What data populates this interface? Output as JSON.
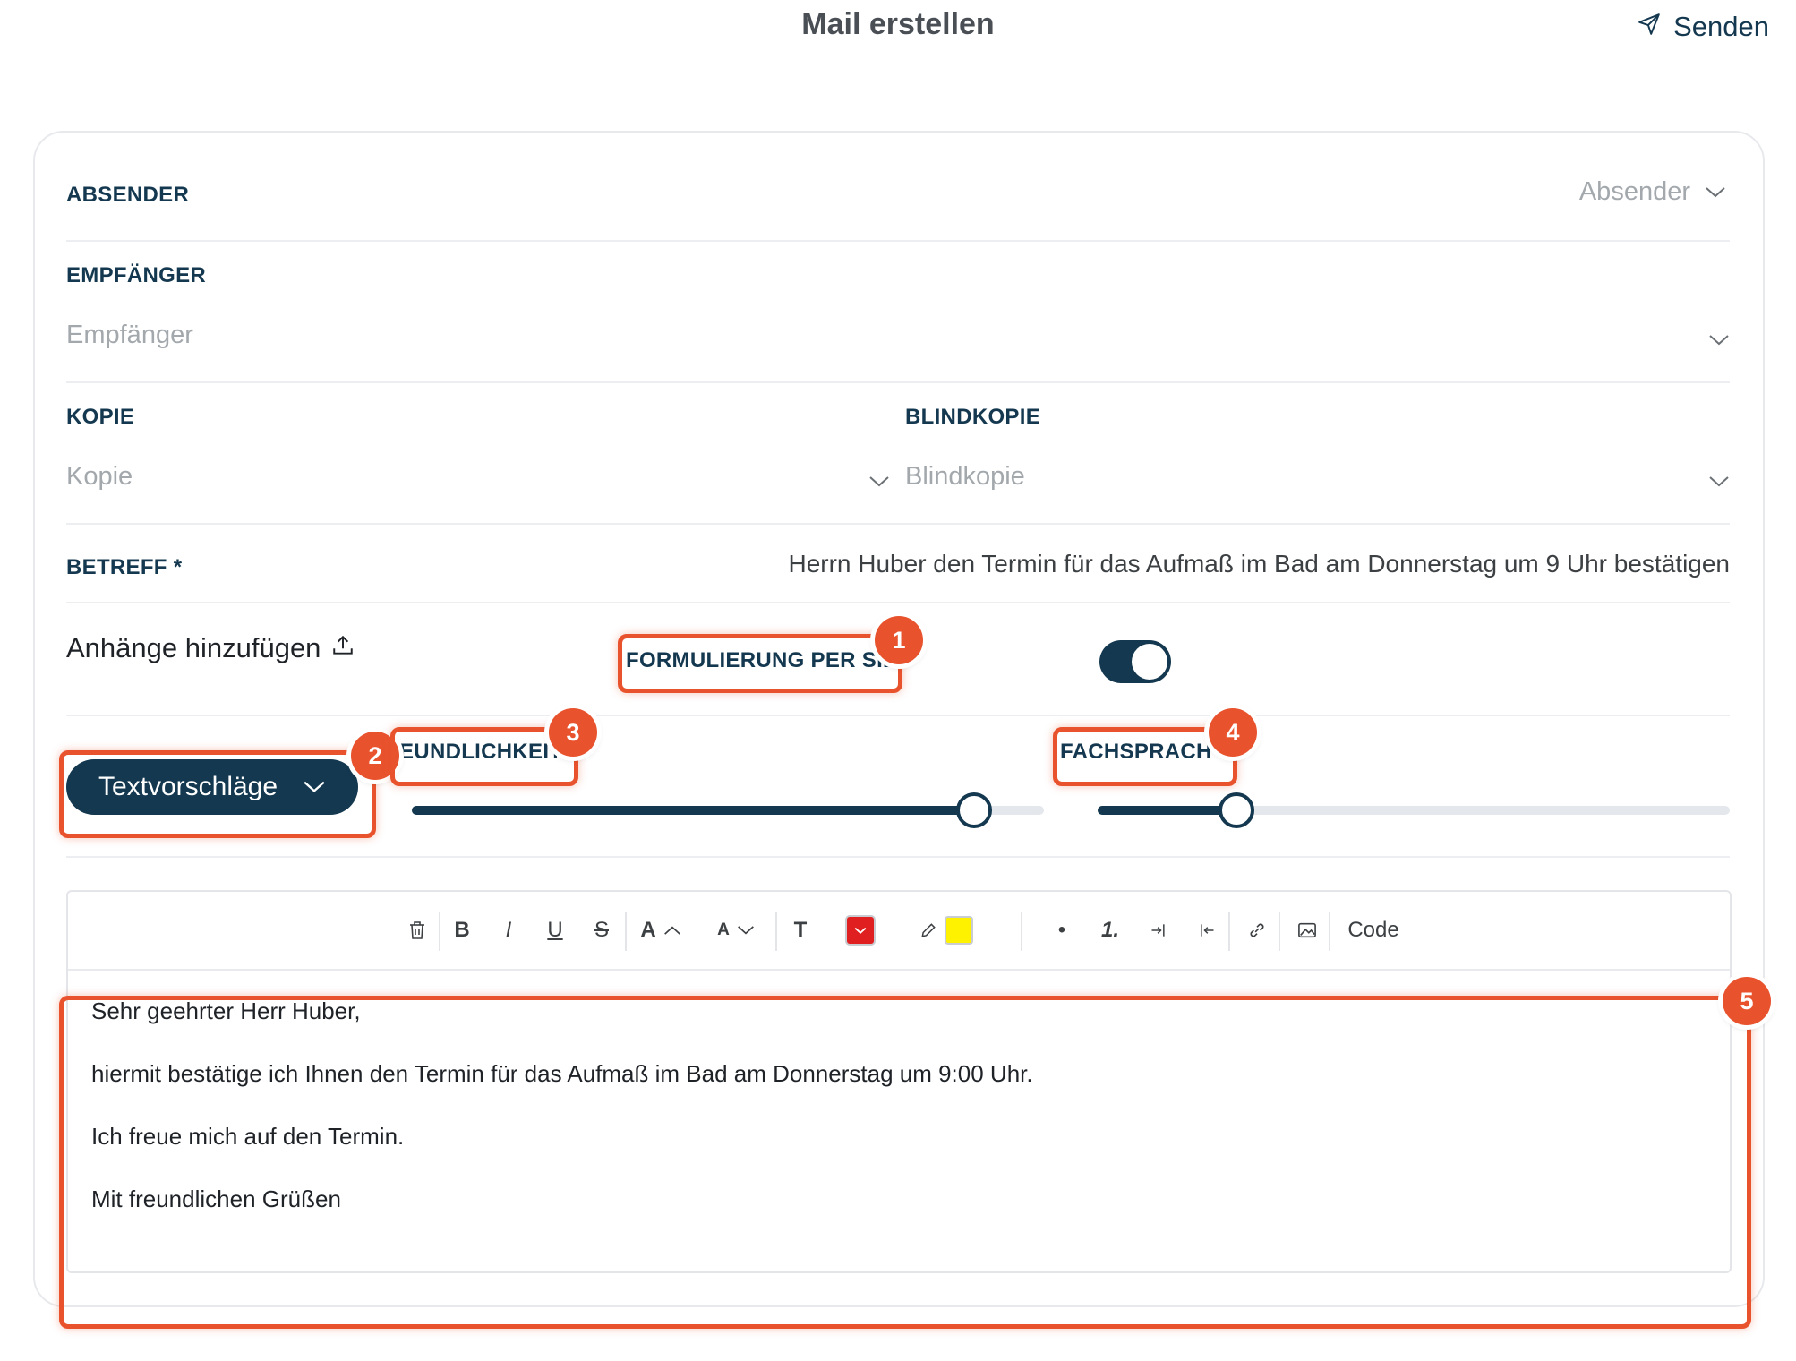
{
  "header": {
    "title": "Mail erstellen",
    "send_label": "Senden",
    "send_icon": "paper-plane-icon"
  },
  "form": {
    "sender": {
      "label": "ABSENDER",
      "placeholder": "Absender"
    },
    "recipient": {
      "label": "EMPFÄNGER",
      "placeholder": "Empfänger"
    },
    "cc": {
      "label": "KOPIE",
      "placeholder": "Kopie"
    },
    "bcc": {
      "label": "BLINDKOPIE",
      "placeholder": "Blindkopie"
    },
    "subject": {
      "label": "BETREFF *",
      "value": "Herrn Huber den Termin für das Aufmaß im Bad am Donnerstag um 9 Uhr bestätigen"
    },
    "attachments_label": "Anhänge hinzufügen",
    "formal_address": {
      "label": "FORMULIERUNG PER SIE",
      "on": true
    },
    "suggestions_button": "Textvorschläge",
    "friendliness": {
      "label": "FREUNDLICHKEIT",
      "visible_label": "EUNDLICHKEIT",
      "level": 0.89
    },
    "technical_language": {
      "label": "FACHSPRACHE",
      "level": 0.22
    }
  },
  "toolbar": {
    "items": [
      "clear-format",
      "bold",
      "italic",
      "underline",
      "strikethrough",
      "font-size-increase",
      "font-size-decrease",
      "text-style",
      "font-color",
      "highlight-color",
      "bullet-list",
      "numbered-list",
      "indent",
      "outdent",
      "link",
      "image",
      "code"
    ],
    "bold": "B",
    "italic": "I",
    "underline": "U",
    "strike": "S",
    "font_up": "A",
    "font_down": "A",
    "text_style": "T",
    "bullet": "•",
    "numbered": "1.",
    "code": "Code",
    "font_color": "#e02020",
    "highlight_color": "#fff200"
  },
  "body": {
    "lines": [
      "Sehr geehrter Herr Huber,",
      "hiermit bestätige ich Ihnen den Termin für das Aufmaß im Bad am Donnerstag um 9:00 Uhr.",
      "Ich freue mich auf den Termin.",
      "Mit freundlichen Grüßen"
    ]
  },
  "annotations": {
    "badges": [
      "1",
      "2",
      "3",
      "4",
      "5"
    ],
    "color": "#e8532e"
  },
  "colors": {
    "primary": "#14384f",
    "annotation": "#e8532e"
  }
}
